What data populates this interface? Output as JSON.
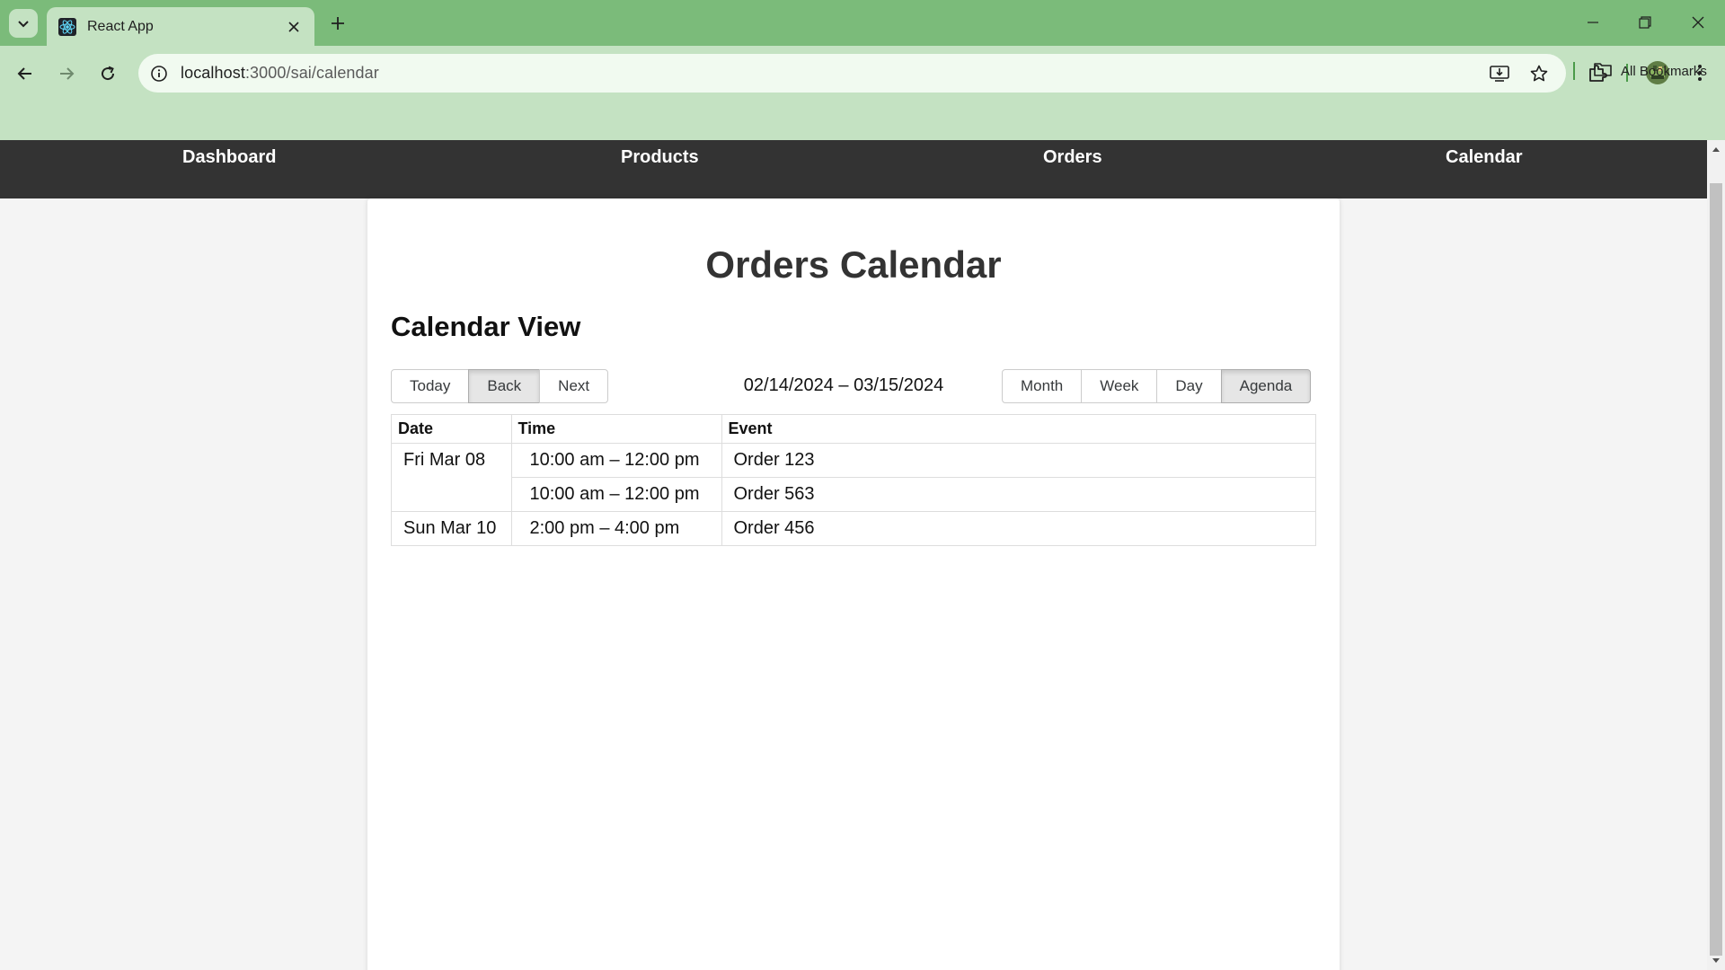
{
  "browser": {
    "tab_title": "React App",
    "url_host": "localhost",
    "url_path": ":3000/sai/calendar",
    "bookmarks_label": "All Bookmarks",
    "colors": {
      "frame": "#7bbb7a",
      "toolbar": "#c4e2c2"
    }
  },
  "nav": {
    "items": [
      {
        "label": "Dashboard"
      },
      {
        "label": "Products"
      },
      {
        "label": "Orders"
      },
      {
        "label": "Calendar"
      }
    ]
  },
  "page": {
    "title": "Orders Calendar",
    "section_title": "Calendar View"
  },
  "calendar": {
    "nav_buttons": {
      "today": "Today",
      "back": "Back",
      "next": "Next"
    },
    "range_label": "02/14/2024 – 03/15/2024",
    "views": {
      "month": "Month",
      "week": "Week",
      "day": "Day",
      "agenda": "Agenda"
    },
    "active_view": "Agenda",
    "agenda": {
      "headers": {
        "date": "Date",
        "time": "Time",
        "event": "Event"
      },
      "rows": [
        {
          "date": "Fri Mar 08",
          "time": "10:00 am – 12:00 pm",
          "event": "Order 123"
        },
        {
          "date": "",
          "time": "10:00 am – 12:00 pm",
          "event": "Order 563"
        },
        {
          "date": "Sun Mar 10",
          "time": "2:00 pm – 4:00 pm",
          "event": "Order 456"
        }
      ]
    }
  }
}
